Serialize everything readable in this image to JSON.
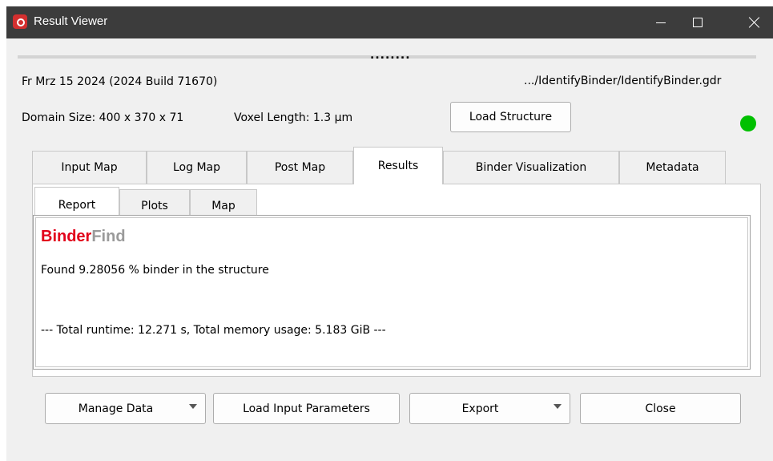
{
  "window": {
    "title": "Result Viewer",
    "icon": "app-logo-icon",
    "controls": {
      "minimize": "minimize-icon",
      "maximize": "maximize-icon",
      "close": "close-icon"
    }
  },
  "splitter": {
    "grip": "........"
  },
  "header": {
    "date_build": "Fr Mrz 15 2024 (2024 Build 71670)",
    "file_path": ".../IdentifyBinder/IdentifyBinder.gdr",
    "domain_size": "Domain Size: 400 x 370 x 71",
    "voxel_length": "Voxel Length: 1.3 µm",
    "load_structure_label": "Load Structure",
    "status_color": "#00c000"
  },
  "tabs": [
    {
      "label": "Input Map"
    },
    {
      "label": "Log Map"
    },
    {
      "label": "Post Map"
    },
    {
      "label": "Results",
      "active": true
    },
    {
      "label": "Binder Visualization"
    },
    {
      "label": "Metadata"
    }
  ],
  "subtabs": [
    {
      "label": "Report",
      "active": true
    },
    {
      "label": "Plots"
    },
    {
      "label": "Map"
    }
  ],
  "report": {
    "brand_part1": "Binder",
    "brand_part2": "Find",
    "brand_color1": "#e2001a",
    "brand_color2": "#9a9a9a",
    "found_line": "Found 9.28056 % binder in the structure",
    "runtime_line": "--- Total runtime: 12.271 s, Total memory usage: 5.183 GiB ---"
  },
  "footer": {
    "manage_data_label": "Manage Data",
    "load_input_label": "Load Input Parameters",
    "export_label": "Export",
    "close_label": "Close"
  }
}
